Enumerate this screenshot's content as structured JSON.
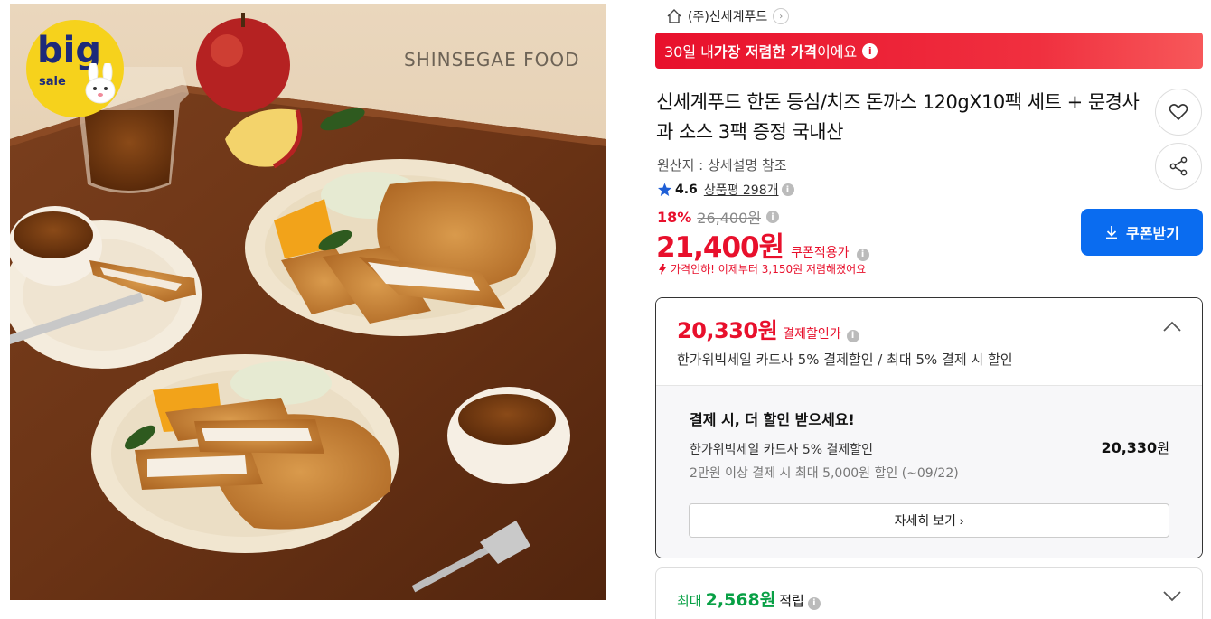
{
  "photo": {
    "watermark": "SHINSEGAE FOOD",
    "badge_big": "big",
    "badge_sale": "sale",
    "alt_icon": "product-photo-tonkatsu"
  },
  "seller": {
    "name": "(주)신세계푸드",
    "icon": "home-icon"
  },
  "banner": {
    "prefix": "30일 내 ",
    "highlight": "가장 저렴한 가격",
    "suffix": "이에요",
    "info": "i"
  },
  "product": {
    "title": "신세계푸드 한돈 등심/치즈 돈까스 120gX10팩 세트 + 문경사과 소스 3팩 증정 국내산",
    "origin": "원산지 : 상세설명 참조",
    "rating": "4.6",
    "reviews_label": "상품평 298개",
    "discount_rate": "18%",
    "original_price": "26,400원",
    "price": "21,400원",
    "price_label": "쿠폰적용가",
    "price_drop": "가격인하! 이제부터 3,150원 저렴해졌어요"
  },
  "coupon_button": "쿠폰받기",
  "payment": {
    "price": "20,330원",
    "label": "결제할인가",
    "desc": "한가위빅세일 카드사 5% 결제할인 / 최대 5% 결제 시 할인",
    "more_title": "결제 시, 더 할인 받으세요!",
    "card_name": "한가위빅세일 카드사 5% 결제할인",
    "card_amount_num": "20,330",
    "card_amount_unit": "원",
    "card_condition": "2만원 이상 결제 시 최대 5,000원 할인 (~09/22)",
    "detail_button": "자세히 보기 ›"
  },
  "points": {
    "prefix": "최대",
    "amount": "2,568원",
    "suffix": "적립"
  },
  "colors": {
    "accent_red": "#e8102c",
    "coupon_blue": "#0a6cf0",
    "point_green": "#08a045",
    "badge_yellow": "#f6d21c"
  }
}
